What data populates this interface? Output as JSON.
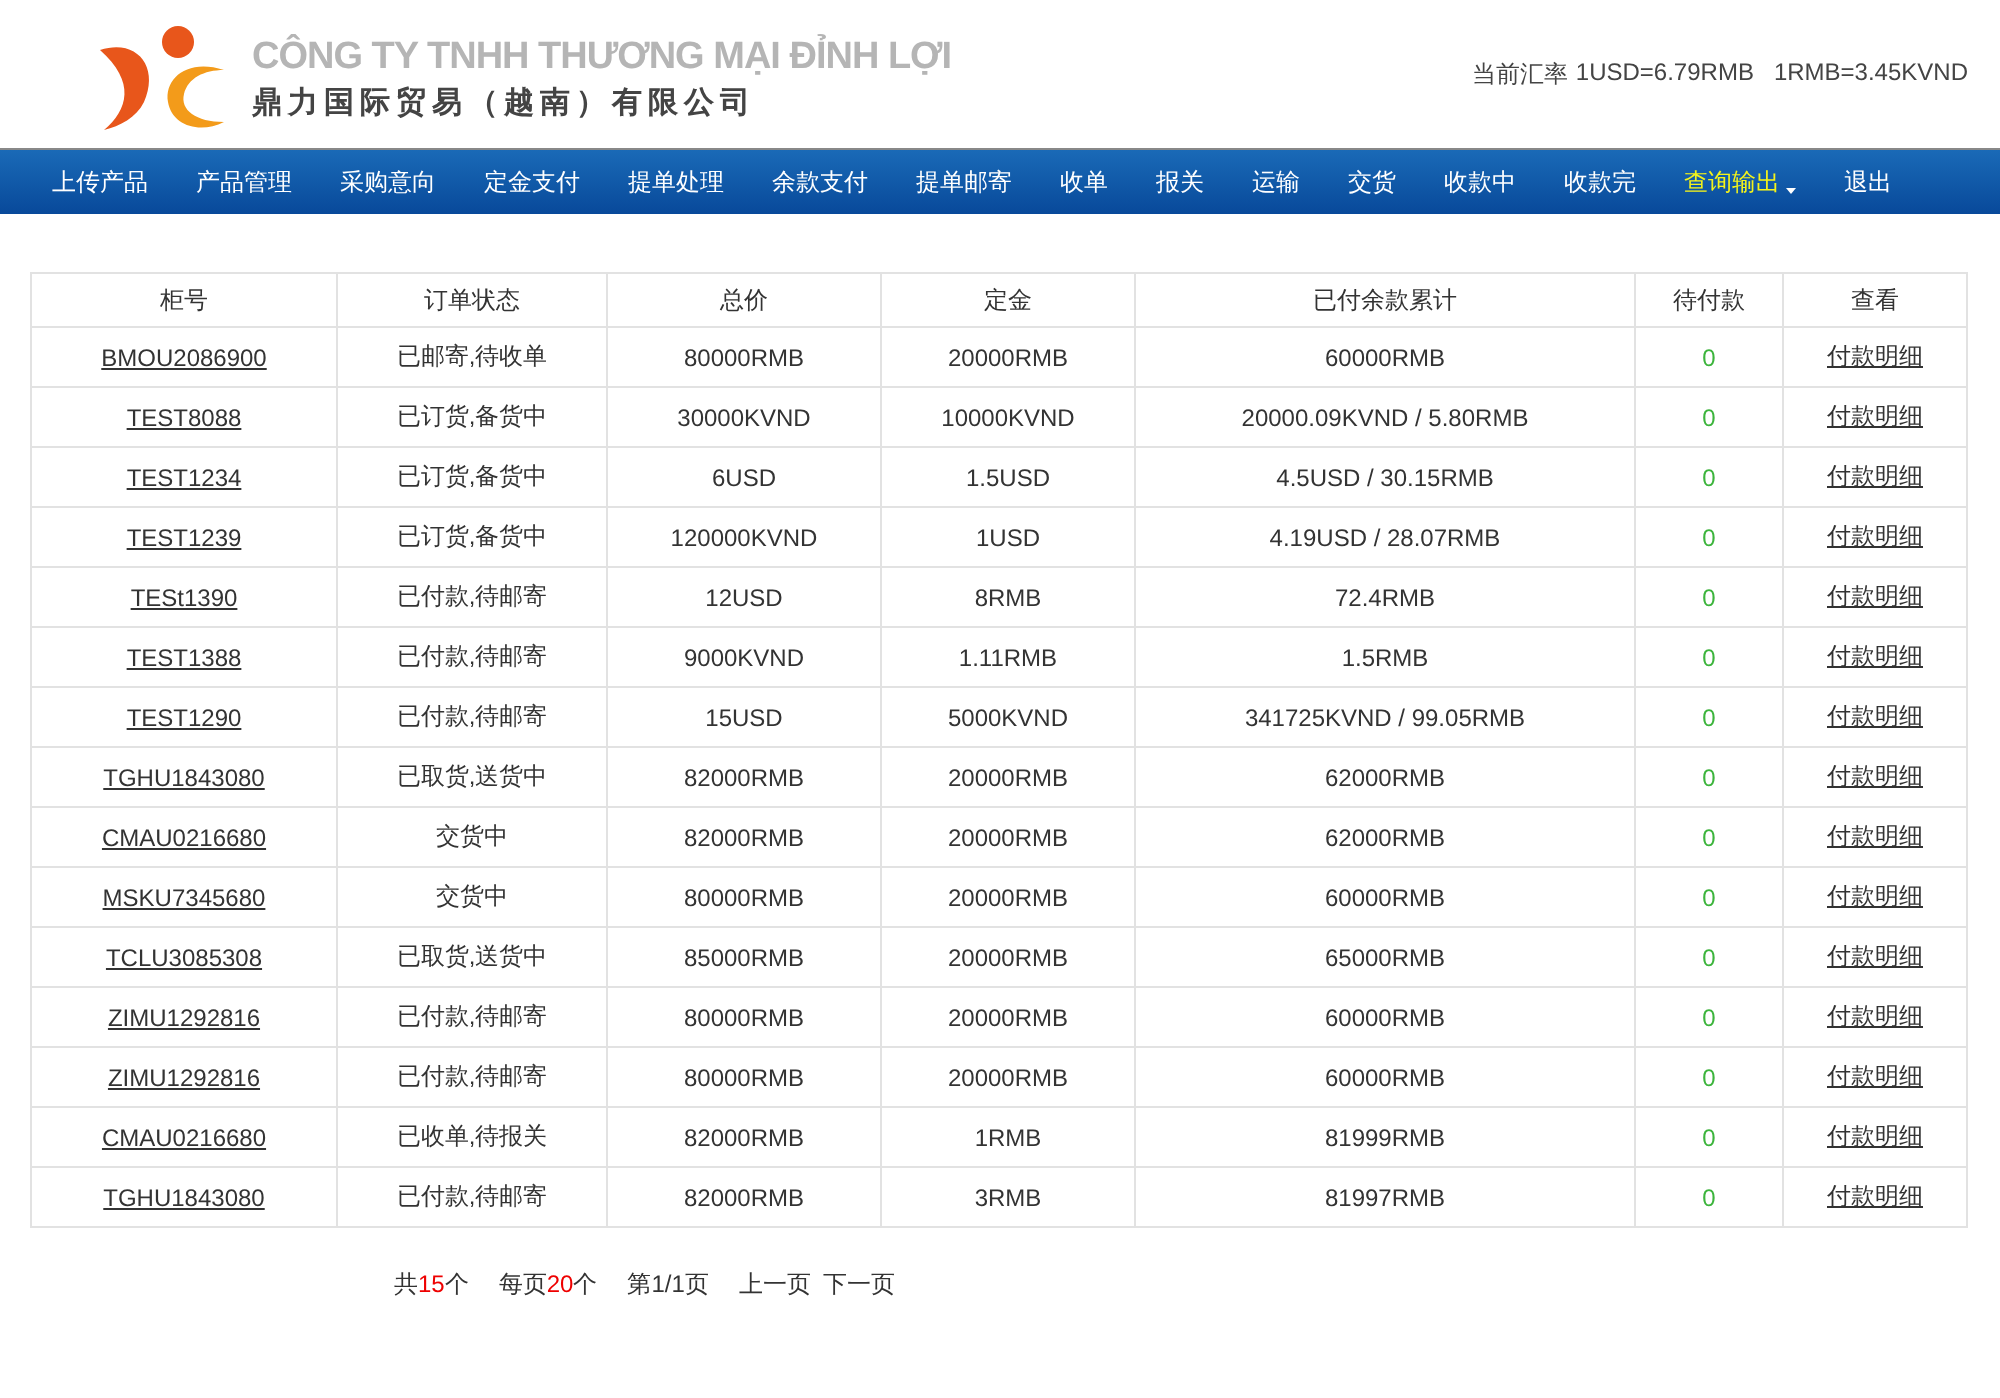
{
  "header": {
    "company_vi": "CÔNG TY TNHH THƯƠNG MẠI ĐỈNH LỢI",
    "company_zh": "鼎力国际贸易（越南）有限公司",
    "rate_label": "当前汇率",
    "rate_usd": "1USD=6.79RMB",
    "rate_rmb": "1RMB=3.45KVND"
  },
  "nav": [
    {
      "label": "上传产品",
      "selected": false,
      "dropdown": false
    },
    {
      "label": "产品管理",
      "selected": false,
      "dropdown": false
    },
    {
      "label": "采购意向",
      "selected": false,
      "dropdown": false
    },
    {
      "label": "定金支付",
      "selected": false,
      "dropdown": false
    },
    {
      "label": "提单处理",
      "selected": false,
      "dropdown": false
    },
    {
      "label": "余款支付",
      "selected": false,
      "dropdown": false
    },
    {
      "label": "提单邮寄",
      "selected": false,
      "dropdown": false
    },
    {
      "label": "收单",
      "selected": false,
      "dropdown": false
    },
    {
      "label": "报关",
      "selected": false,
      "dropdown": false
    },
    {
      "label": "运输",
      "selected": false,
      "dropdown": false
    },
    {
      "label": "交货",
      "selected": false,
      "dropdown": false
    },
    {
      "label": "收款中",
      "selected": false,
      "dropdown": false
    },
    {
      "label": "收款完",
      "selected": false,
      "dropdown": false
    },
    {
      "label": "查询输出",
      "selected": true,
      "dropdown": true
    },
    {
      "label": "退出",
      "selected": false,
      "dropdown": false
    }
  ],
  "table": {
    "columns": [
      "柜号",
      "订单状态",
      "总价",
      "定金",
      "已付余款累计",
      "待付款",
      "查看"
    ],
    "rows": [
      [
        "BMOU2086900",
        "已邮寄,待收单",
        "80000RMB",
        "20000RMB",
        "60000RMB",
        "0",
        "付款明细"
      ],
      [
        "TEST8088",
        "已订货,备货中",
        "30000KVND",
        "10000KVND",
        "20000.09KVND / 5.80RMB",
        "0",
        "付款明细"
      ],
      [
        "TEST1234",
        "已订货,备货中",
        "6USD",
        "1.5USD",
        "4.5USD / 30.15RMB",
        "0",
        "付款明细"
      ],
      [
        "TEST1239",
        "已订货,备货中",
        "120000KVND",
        "1USD",
        "4.19USD / 28.07RMB",
        "0",
        "付款明细"
      ],
      [
        "TESt1390",
        "已付款,待邮寄",
        "12USD",
        "8RMB",
        "72.4RMB",
        "0",
        "付款明细"
      ],
      [
        "TEST1388",
        "已付款,待邮寄",
        "9000KVND",
        "1.11RMB",
        "1.5RMB",
        "0",
        "付款明细"
      ],
      [
        "TEST1290",
        "已付款,待邮寄",
        "15USD",
        "5000KVND",
        "341725KVND / 99.05RMB",
        "0",
        "付款明细"
      ],
      [
        "TGHU1843080",
        "已取货,送货中",
        "82000RMB",
        "20000RMB",
        "62000RMB",
        "0",
        "付款明细"
      ],
      [
        "CMAU0216680",
        "交货中",
        "82000RMB",
        "20000RMB",
        "62000RMB",
        "0",
        "付款明细"
      ],
      [
        "MSKU7345680",
        "交货中",
        "80000RMB",
        "20000RMB",
        "60000RMB",
        "0",
        "付款明细"
      ],
      [
        "TCLU3085308",
        "已取货,送货中",
        "85000RMB",
        "20000RMB",
        "65000RMB",
        "0",
        "付款明细"
      ],
      [
        "ZIMU1292816",
        "已付款,待邮寄",
        "80000RMB",
        "20000RMB",
        "60000RMB",
        "0",
        "付款明细"
      ],
      [
        "ZIMU1292816",
        "已付款,待邮寄",
        "80000RMB",
        "20000RMB",
        "60000RMB",
        "0",
        "付款明细"
      ],
      [
        "CMAU0216680",
        "已收单,待报关",
        "82000RMB",
        "1RMB",
        "81999RMB",
        "0",
        "付款明细"
      ],
      [
        "TGHU1843080",
        "已付款,待邮寄",
        "82000RMB",
        "3RMB",
        "81997RMB",
        "0",
        "付款明细"
      ]
    ]
  },
  "pager": {
    "total": {
      "before": "共",
      "number": "15",
      "after": "个"
    },
    "per_page": {
      "before": "每页",
      "number": "20",
      "after": "个"
    },
    "page": "第1/1页",
    "prev": "上一页",
    "next": "下一页"
  }
}
